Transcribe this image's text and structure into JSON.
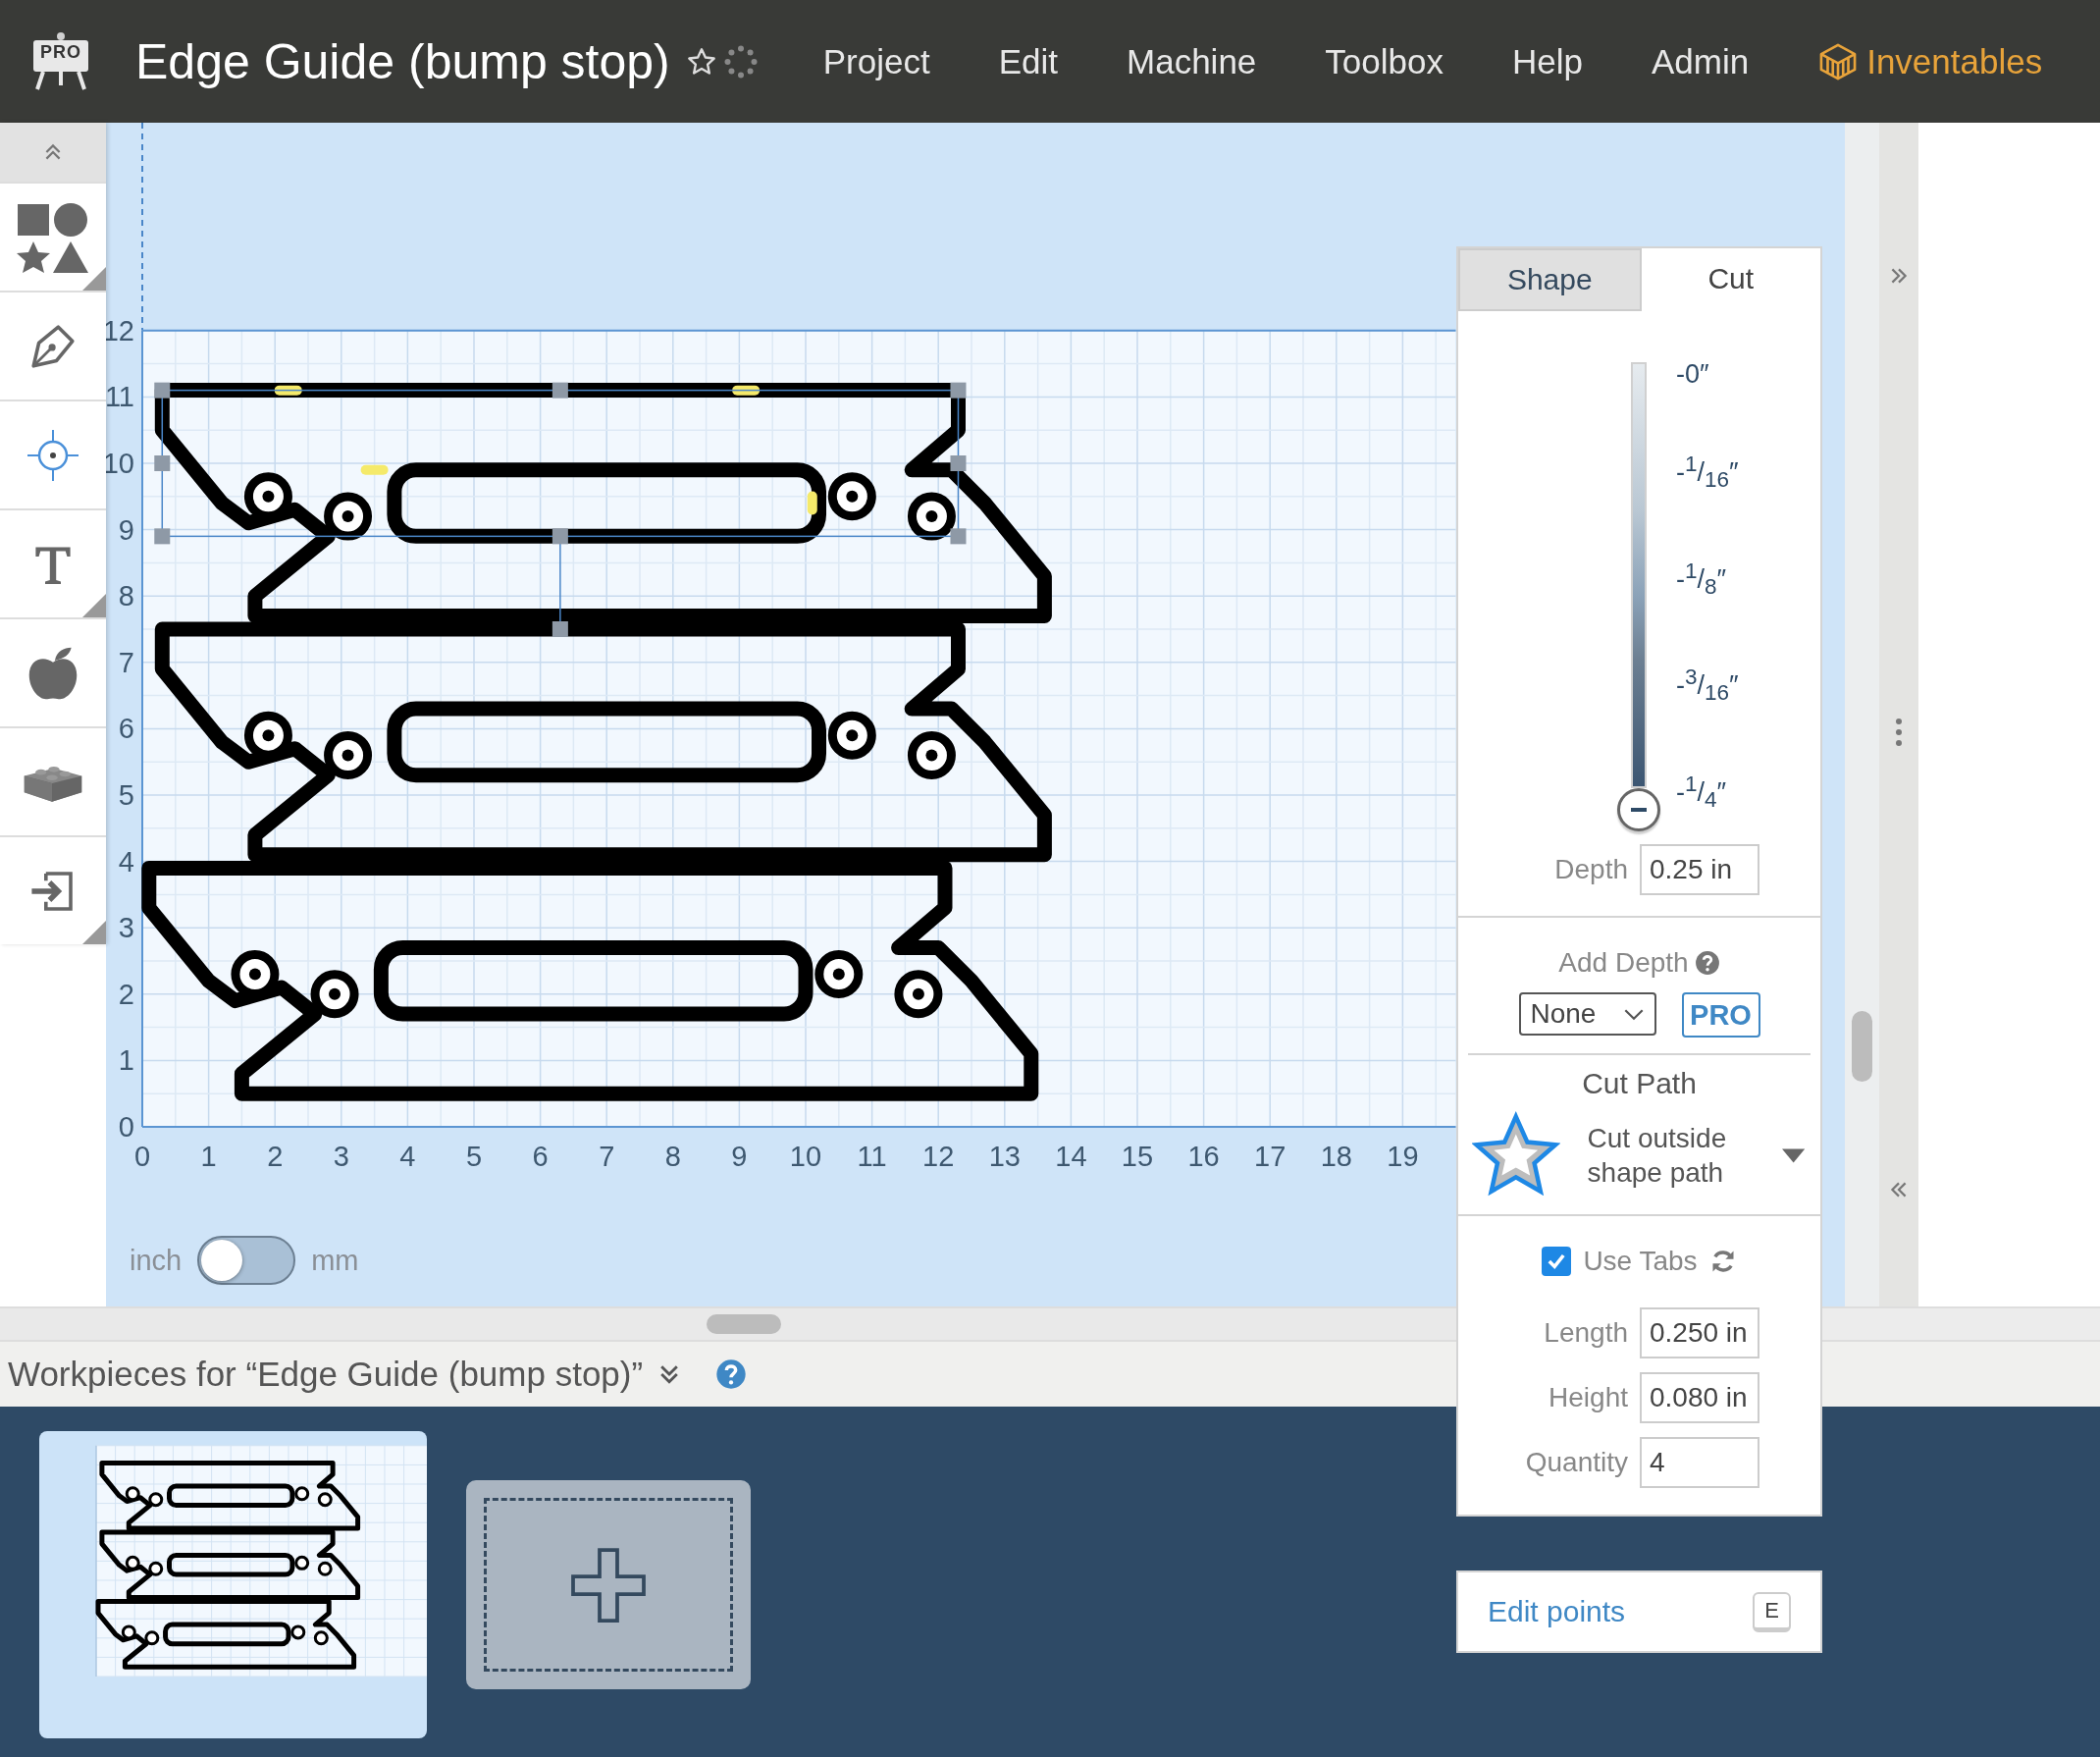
{
  "header": {
    "badge": "PRO",
    "title": "Edge Guide (bump stop)",
    "menu": [
      "Project",
      "Edit",
      "Machine",
      "Toolbox",
      "Help",
      "Admin"
    ],
    "brand": "Inventables"
  },
  "canvas": {
    "y_ticks": [
      "12",
      "11",
      "10",
      "9",
      "8",
      "7",
      "6",
      "5",
      "4",
      "3",
      "2",
      "1",
      "0"
    ],
    "x_ticks": [
      "0",
      "1",
      "2",
      "3",
      "4",
      "5",
      "6",
      "7",
      "8",
      "9",
      "10",
      "11",
      "12",
      "13",
      "14",
      "15",
      "16",
      "17",
      "18",
      "19"
    ]
  },
  "units": {
    "left": "inch",
    "right": "mm",
    "on": false
  },
  "panel": {
    "tabs": [
      {
        "label": "Shape",
        "selected": false
      },
      {
        "label": "Cut",
        "selected": true
      }
    ],
    "depth_scale": {
      "labels": [
        "-0″",
        "-$^{1}$/$_{16}$″",
        "-$^{1}$/$_{8}$″",
        "-$^{3}$/$_{16}$″",
        "-$^{1}$/$_{4}$″"
      ],
      "level": 1
    },
    "depth": {
      "label": "Depth",
      "value": "0.25 in"
    },
    "add_depth": {
      "label": "Add Depth",
      "value": "None",
      "badge": "PRO"
    },
    "cut_path": {
      "title": "Cut Path",
      "option": "Cut outside shape path"
    },
    "use_tabs": {
      "label": "Use Tabs",
      "checked": true
    },
    "fields": [
      {
        "label": "Length",
        "value": "0.250 in"
      },
      {
        "label": "Height",
        "value": "0.080 in"
      },
      {
        "label": "Quantity",
        "value": "4"
      }
    ]
  },
  "edit_points": {
    "label": "Edit points",
    "key": "E"
  },
  "workpieces": {
    "title": "Workpieces for “Edge Guide (bump stop)”"
  }
}
